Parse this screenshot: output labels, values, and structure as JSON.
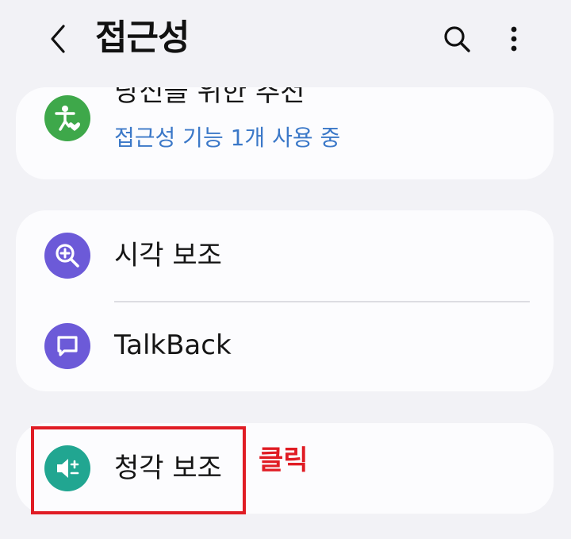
{
  "header": {
    "title": "접근성",
    "back_icon": "chevron-left-icon",
    "search_icon": "search-icon",
    "more_icon": "more-vertical-icon"
  },
  "recommendations": {
    "title": "당신을 위한 추천",
    "subtitle": "접근성 기능 1개 사용 중",
    "icon": "accessibility-person-heart-icon",
    "icon_color": "#3ea84a",
    "subtitle_color": "#3b78c8"
  },
  "settings": {
    "vision": {
      "label": "시각 보조",
      "icon": "magnifier-plus-icon",
      "icon_color": "#6c5ad8"
    },
    "talkback": {
      "label": "TalkBack",
      "icon": "speech-bubble-icon",
      "icon_color": "#6c5ad8"
    },
    "hearing": {
      "label": "청각 보조",
      "icon": "speaker-plus-minus-icon",
      "icon_color": "#21a691"
    }
  },
  "annotation": {
    "label": "클릭",
    "color": "#e01c24"
  }
}
